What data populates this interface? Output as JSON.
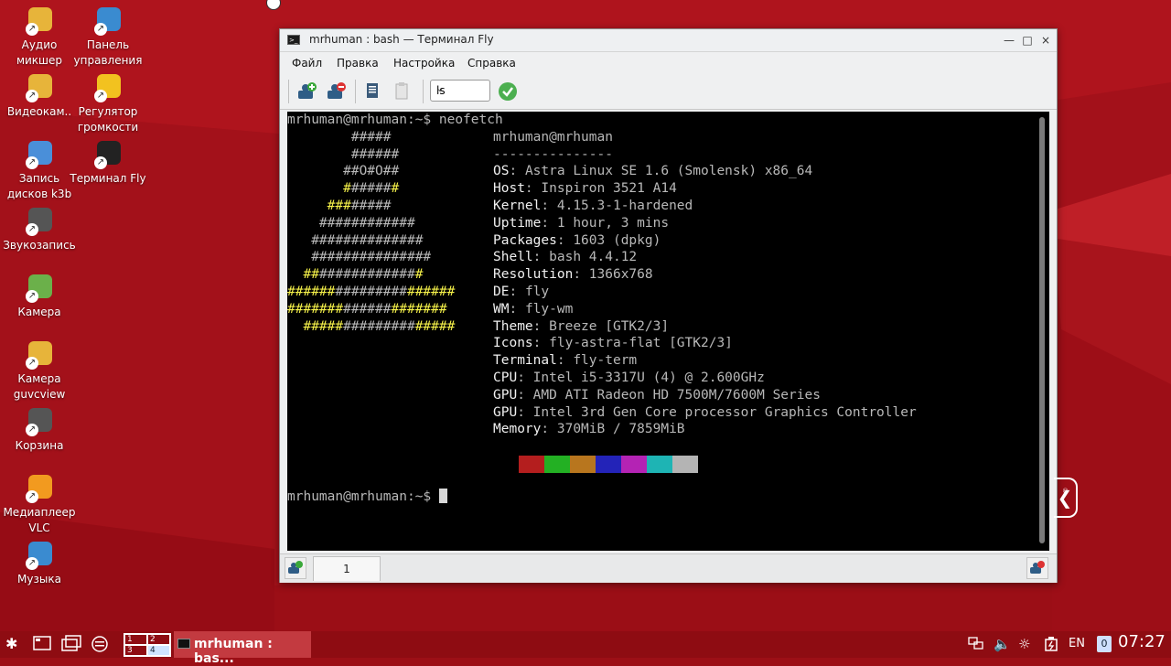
{
  "desktop_icons": [
    {
      "label": "Аудио микшер",
      "icon": "audio-mixer-icon"
    },
    {
      "label": "Панель управления",
      "icon": "control-panel-icon"
    },
    {
      "label": "Видеокам..",
      "icon": "video-camera-icon"
    },
    {
      "label": "Регулятор громкости",
      "icon": "volume-control-icon"
    },
    {
      "label": "Запись дисков k3b",
      "icon": "disc-burning-icon"
    },
    {
      "label": "Терминал Fly",
      "icon": "terminal-icon"
    },
    {
      "label": "Звукозапись",
      "icon": "microphone-icon"
    },
    {
      "label": "Камера",
      "icon": "camera-icon"
    },
    {
      "label": "Камера guvcview",
      "icon": "webcam-icon"
    },
    {
      "label": "Корзина",
      "icon": "trash-icon"
    },
    {
      "label": "Медиаплеер VLC",
      "icon": "vlc-icon"
    },
    {
      "label": "Музыка",
      "icon": "music-icon"
    }
  ],
  "window": {
    "title": "mrhuman : bash — Терминал Fly",
    "controls": {
      "minimize": "—",
      "maximize": "□",
      "close": "×"
    },
    "menu": [
      "Файл",
      "Правка",
      "Настройка",
      "Справка"
    ],
    "toolbar": {
      "combo_value": "ls",
      "icons": [
        "new-session-icon",
        "close-session-icon",
        "copy-icon",
        "paste-icon",
        "execute-icon"
      ]
    },
    "terminal": {
      "prompt_command": "mrhuman@mrhuman:~$ neofetch",
      "logo": [
        [
          "        ",
          "",
          "#####",
          ""
        ],
        [
          "        ",
          "",
          "######",
          ""
        ],
        [
          "       ",
          "",
          "##O#O##",
          ""
        ],
        [
          "       ",
          "#",
          "#####",
          "#"
        ],
        [
          "     ",
          "",
          "###",
          "#####",
          "###"
        ],
        [
          "    ",
          "",
          "############",
          ""
        ],
        [
          "   ",
          "",
          "##############",
          ""
        ],
        [
          "   ",
          "",
          "###############",
          ""
        ],
        [
          "  ",
          "##",
          "############",
          "#"
        ],
        [
          "",
          "######",
          "#########",
          "######"
        ],
        [
          "",
          "#######",
          "######",
          "#######"
        ],
        [
          "  ",
          "#####",
          "#########",
          "#####"
        ]
      ],
      "user_host": "mrhuman@mrhuman",
      "separator": "---------------",
      "info": [
        {
          "key": "OS",
          "value": "Astra Linux SE 1.6 (Smolensk) x86_64"
        },
        {
          "key": "Host",
          "value": "Inspiron 3521 A14"
        },
        {
          "key": "Kernel",
          "value": "4.15.3-1-hardened"
        },
        {
          "key": "Uptime",
          "value": "1 hour, 3 mins"
        },
        {
          "key": "Packages",
          "value": "1603 (dpkg)"
        },
        {
          "key": "Shell",
          "value": "bash 4.4.12"
        },
        {
          "key": "Resolution",
          "value": "1366x768"
        },
        {
          "key": "DE",
          "value": "fly"
        },
        {
          "key": "WM",
          "value": "fly-wm"
        },
        {
          "key": "Theme",
          "value": "Breeze [GTK2/3]"
        },
        {
          "key": "Icons",
          "value": "fly-astra-flat [GTK2/3]"
        },
        {
          "key": "Terminal",
          "value": "fly-term"
        },
        {
          "key": "CPU",
          "value": "Intel i5-3317U (4) @ 2.600GHz"
        },
        {
          "key": "GPU",
          "value": "AMD ATI Radeon HD 7500M/7600M Series"
        },
        {
          "key": "GPU",
          "value": "Intel 3rd Gen Core processor Graphics Controller"
        },
        {
          "key": "Memory",
          "value": "370MiB / 7859MiB"
        }
      ],
      "swatch_colors": [
        "#b41e1e",
        "#23b023",
        "#b8761e",
        "#2323b8",
        "#b423b4",
        "#1eb4b4",
        "#b4b4b4"
      ],
      "final_prompt": "mrhuman@mrhuman:~$ "
    },
    "tab_label": "1"
  },
  "taskbar": {
    "pager": [
      "1",
      "2",
      "3",
      "4"
    ],
    "task_label": "mrhuman : bas...",
    "lang": "EN",
    "badge": "0",
    "clock": "07:27"
  }
}
